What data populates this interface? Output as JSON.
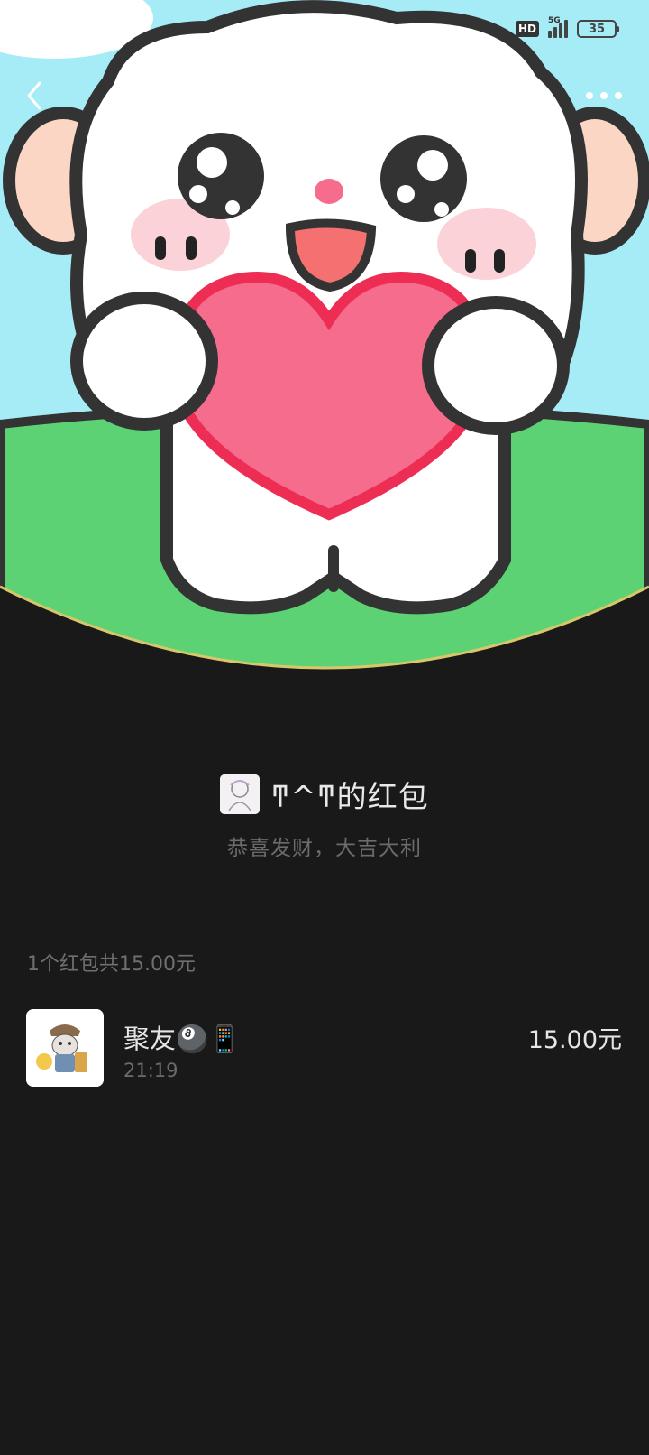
{
  "status_bar": {
    "hd_label": "HD",
    "network_label": "5G",
    "battery_level": "35"
  },
  "nav": {
    "back_icon": "chevron-left-icon",
    "more_icon": "more-dots-icon"
  },
  "envelope": {
    "sender_title": "ͳ^ͳ的红包",
    "blessing": "恭喜发财，大吉大利",
    "summary": "1个红包共15.00元"
  },
  "receivers": [
    {
      "name": "聚友🎱📱",
      "time": "21:19",
      "amount": "15.00元"
    }
  ],
  "colors": {
    "background": "#191919",
    "sky": "#a6ecf7",
    "grass": "#5cd274",
    "heart": "#f56c8c",
    "cover_rim": "#d8c76a"
  }
}
